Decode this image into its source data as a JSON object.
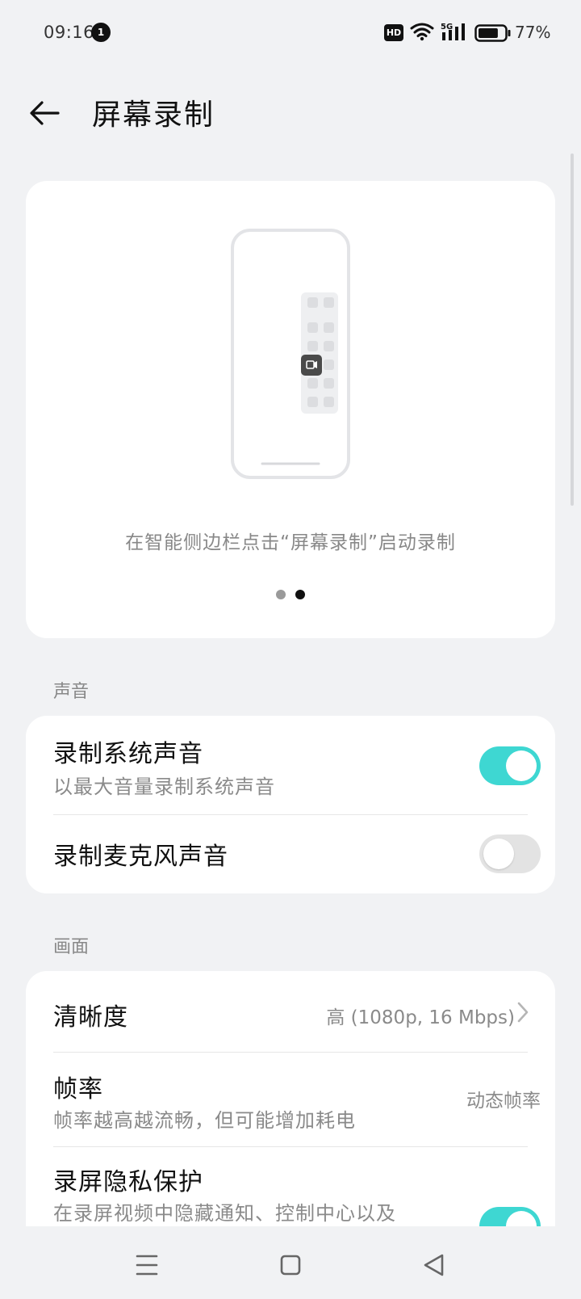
{
  "status_bar": {
    "time": "09:16",
    "notification_count": "1",
    "hd_label": "HD",
    "network_label": "5G",
    "battery_percent": "77%",
    "battery_level": 0.77
  },
  "header": {
    "title": "屏幕录制"
  },
  "preview": {
    "caption": "在智能侧边栏点击“屏幕录制”启动录制",
    "page_count": 2,
    "active_page": 1
  },
  "sound_section": {
    "label": "声音",
    "items": [
      {
        "title": "录制系统声音",
        "subtitle": "以最大音量录制系统声音",
        "enabled": true
      },
      {
        "title": "录制麦克风声音",
        "enabled": false
      }
    ]
  },
  "picture_section": {
    "label": "画面",
    "items": [
      {
        "title": "清晰度",
        "value": "高 (1080p, 16 Mbps)"
      },
      {
        "title": "帧率",
        "subtitle": "帧率越高越流畅，但可能增加耗电",
        "value": "动态帧率"
      },
      {
        "title": "录屏隐私保护",
        "subtitle": "在录屏视频中隐藏通知、控制中心以及",
        "enabled": true
      }
    ]
  },
  "colors": {
    "accent": "#3ed7d2",
    "background": "#f1f2f4",
    "card": "#ffffff"
  },
  "icons": {
    "back": "arrow-left-icon",
    "nav_menu": "menu-icon",
    "nav_home": "square-icon",
    "nav_back": "triangle-back-icon"
  }
}
